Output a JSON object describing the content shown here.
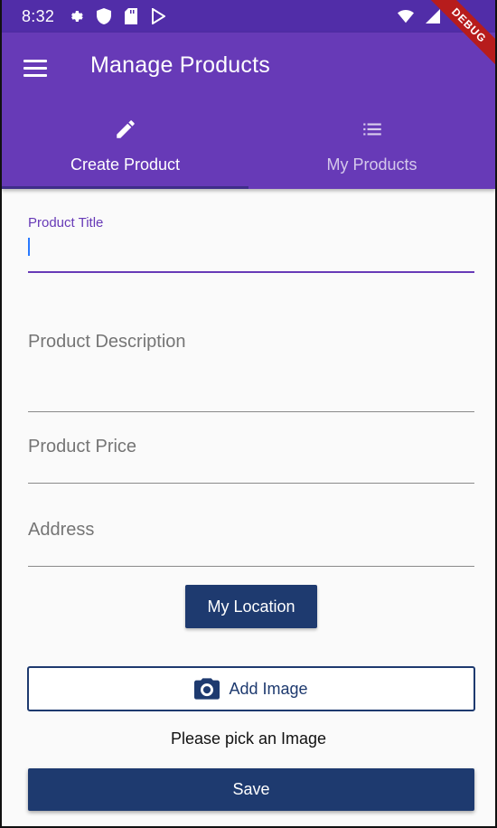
{
  "status_bar": {
    "time": "8:32",
    "icons": [
      "settings-icon",
      "shield-icon",
      "sd-card-icon",
      "play-store-icon",
      "wifi-icon",
      "signal-icon",
      "battery-icon"
    ]
  },
  "app_bar": {
    "title": "Manage Products",
    "menu_icon": "hamburger-menu-icon",
    "debug_banner": "DEBUG",
    "color": "#673ab7",
    "status_color": "#512da8"
  },
  "tabs": [
    {
      "label": "Create Product",
      "icon": "pencil-icon",
      "selected": true
    },
    {
      "label": "My Products",
      "icon": "list-icon",
      "selected": false
    }
  ],
  "form": {
    "title_field": {
      "label": "Product Title",
      "value": ""
    },
    "description_field": {
      "placeholder": "Product Description",
      "value": ""
    },
    "price_field": {
      "placeholder": "Product Price",
      "value": ""
    },
    "address_field": {
      "placeholder": "Address",
      "value": ""
    },
    "location_button": "My Location",
    "image_button": {
      "label": "Add Image",
      "icon": "camera-icon"
    },
    "image_hint": "Please pick an Image",
    "save_button": "Save",
    "accent": "#1e3a6f"
  }
}
